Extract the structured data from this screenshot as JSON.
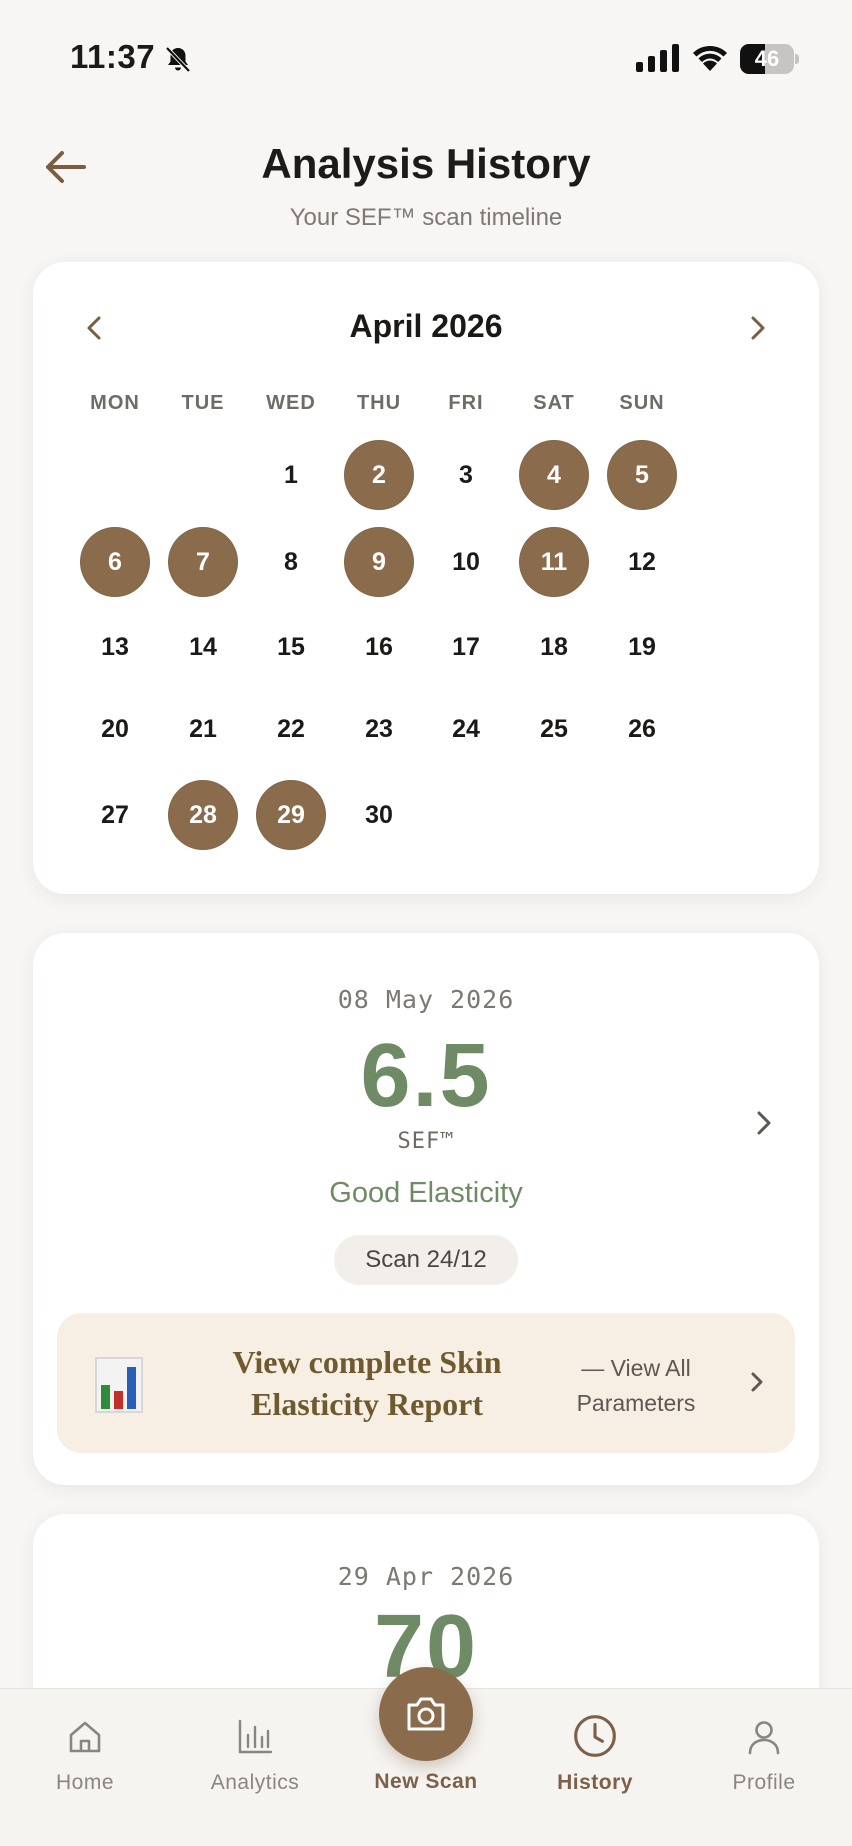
{
  "status_bar": {
    "time": "11:37",
    "battery_percent": 46,
    "battery_label": "46"
  },
  "header": {
    "title": "Analysis History",
    "subtitle": "Your SEF™ scan timeline"
  },
  "calendar": {
    "month_label": "April 2026",
    "weekdays": [
      "MON",
      "TUE",
      "WED",
      "THU",
      "FRI",
      "SAT",
      "SUN"
    ],
    "first_weekday_index": 2,
    "days_in_month": 30,
    "scan_days": [
      2,
      4,
      5,
      6,
      7,
      9,
      11,
      28,
      29
    ],
    "scan_color": "#8a6c4c"
  },
  "latest_scan": {
    "date": "08 May 2026",
    "score": "6.5",
    "unit": "SEF™",
    "status": "Good Elasticity",
    "badge": "Scan 24/12",
    "score_color": "#6f8b66"
  },
  "report_banner": {
    "icon": "bar-chart-icon",
    "title": "View complete Skin Elasticity Report",
    "link_line1": "— View All",
    "link_line2": "Parameters"
  },
  "previous_scan": {
    "date": "29 Apr 2026",
    "score": "70"
  },
  "tab_bar": {
    "home": "Home",
    "analytics": "Analytics",
    "new_scan": "New Scan",
    "history": "History",
    "profile": "Profile",
    "active_tab": "History",
    "accent_color": "#7c6048"
  }
}
